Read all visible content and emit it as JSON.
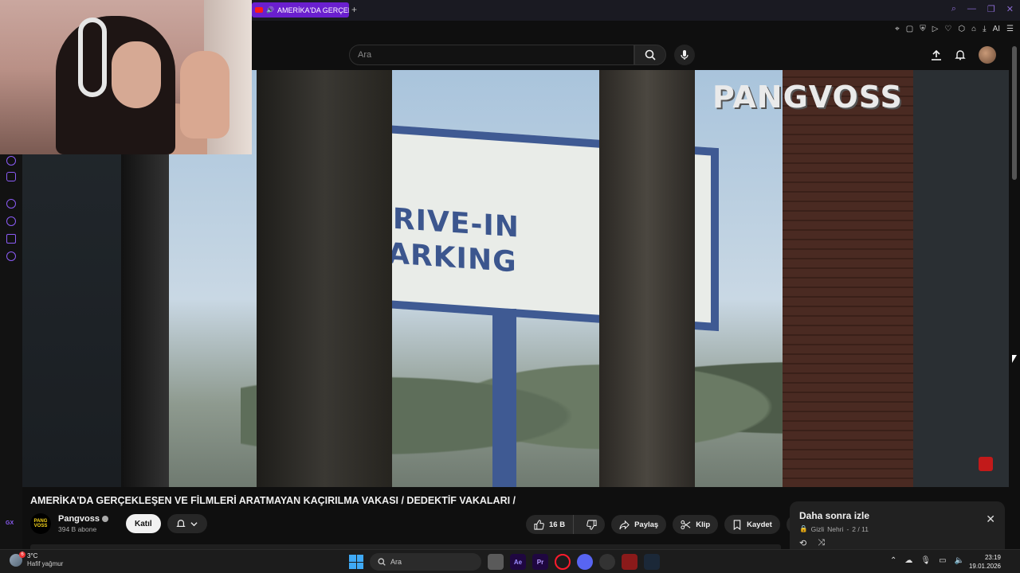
{
  "browser": {
    "tab_title": "AMERİKA'DA GERÇEKL",
    "new_tab_symbol": "+",
    "toolbar_ai": "AI",
    "window_controls": [
      "⌕",
      "—",
      "❐",
      "✕"
    ]
  },
  "youtube": {
    "search_placeholder": "Ara"
  },
  "video": {
    "watermark": "PANGVOSS",
    "sign_line1": "DRIVE-IN",
    "sign_line2": "PARKING",
    "title": "AMERİKA'DA GERÇEKLEŞEN VE FİLMLERİ ARATMAYAN KAÇIRILMA VAKASI / DEDEKTİF VAKALARI /"
  },
  "channel": {
    "logo_text": "PANG VOSS",
    "name": "Pangvoss",
    "subscribers": "394 B abone",
    "join_label": "Katıl"
  },
  "actions": {
    "like_count": "16 B",
    "share_label": "Paylaş",
    "clip_label": "Klip",
    "save_label": "Kaydet"
  },
  "playlist": {
    "title": "Daha sonra izle",
    "privacy": "Gizli",
    "owner": "Nehri",
    "position": "2 / 11"
  },
  "sidebar": {
    "gx_label": "GX"
  },
  "taskbar": {
    "temperature": "3°C",
    "weather_desc": "Hafif yağmur",
    "weather_badge": "6",
    "search_placeholder": "Ara",
    "time": "23:19",
    "date": "19.01.2026",
    "apps": [
      "Ae",
      "Pr"
    ]
  },
  "colors": {
    "accent_purple": "#6a1fcf",
    "opera_purple": "#8b5cf6",
    "youtube_red": "#ff1a1a"
  }
}
